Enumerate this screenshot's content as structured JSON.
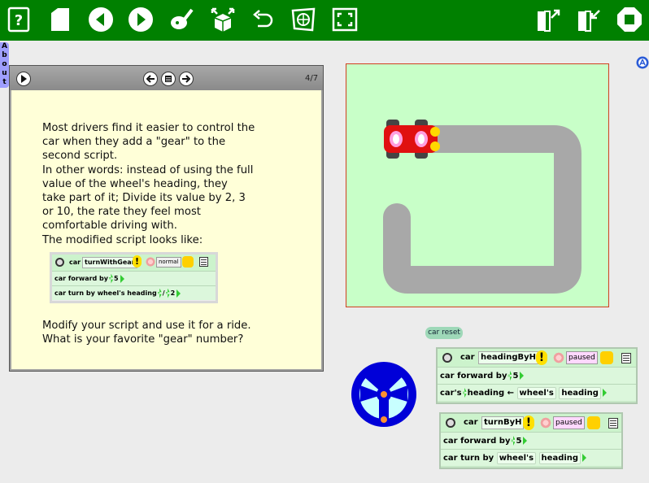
{
  "toolbar": {
    "buttons": [
      {
        "name": "help-button",
        "icon": "help-icon"
      },
      {
        "name": "new-page-button",
        "icon": "page-icon"
      },
      {
        "name": "previous-page-button",
        "icon": "back-arrow-icon"
      },
      {
        "name": "next-page-button",
        "icon": "forward-arrow-icon"
      },
      {
        "name": "paint-button",
        "icon": "paintbrush-icon"
      },
      {
        "name": "supplies-button",
        "icon": "supplies-box-icon"
      },
      {
        "name": "undo-button",
        "icon": "undo-icon"
      },
      {
        "name": "find-button",
        "icon": "find-icon"
      },
      {
        "name": "fullscreen-button",
        "icon": "fullscreen-icon"
      },
      {
        "name": "open-project-button",
        "icon": "open-icon"
      },
      {
        "name": "publish-project-button",
        "icon": "publish-icon"
      },
      {
        "name": "stop-button",
        "icon": "stop-icon"
      }
    ],
    "accent_color": "#008000"
  },
  "about_tab": {
    "letters": [
      "A",
      "b",
      "o",
      "u",
      "t"
    ]
  },
  "book": {
    "page_number": "4/7",
    "paragraph1": "Most drivers find it easier to control the\ncar when they add a \"gear\" to the\nsecond script.\nIn other words: instead of using the full\nvalue of the wheel's heading, they\ntake part of it; Divide its value by 2, 3\nor 10, the rate they feel most\ncomfortable driving with.\nThe modified script looks like:",
    "paragraph2": "Modify your script and use it for a ride.\nWhat is your favorite \"gear\" number?",
    "mini_script": {
      "object": "car",
      "script_name": "turnWithGear",
      "status": "normal",
      "line1": {
        "object": "car",
        "command": "forward by",
        "value": "5"
      },
      "line2": {
        "object": "car",
        "command": "turn by",
        "tile": "wheel's",
        "attr": "heading",
        "op": "/",
        "value": "2"
      }
    }
  },
  "reset_button": {
    "label": "car reset"
  },
  "script_heading": {
    "object": "car",
    "name": "headingByH",
    "status": "paused",
    "line1": {
      "object": "car",
      "command": "forward by",
      "value": "5"
    },
    "line2": {
      "object": "car's",
      "attr": "heading",
      "op": "←",
      "tile": "wheel's",
      "attr2": "heading"
    }
  },
  "script_turn": {
    "object": "car",
    "name": "turnByH",
    "status": "paused",
    "line1": {
      "object": "car",
      "command": "forward by",
      "value": "5"
    },
    "line2": {
      "object": "car",
      "command": "turn by",
      "tile": "wheel's",
      "attr": "heading"
    }
  }
}
